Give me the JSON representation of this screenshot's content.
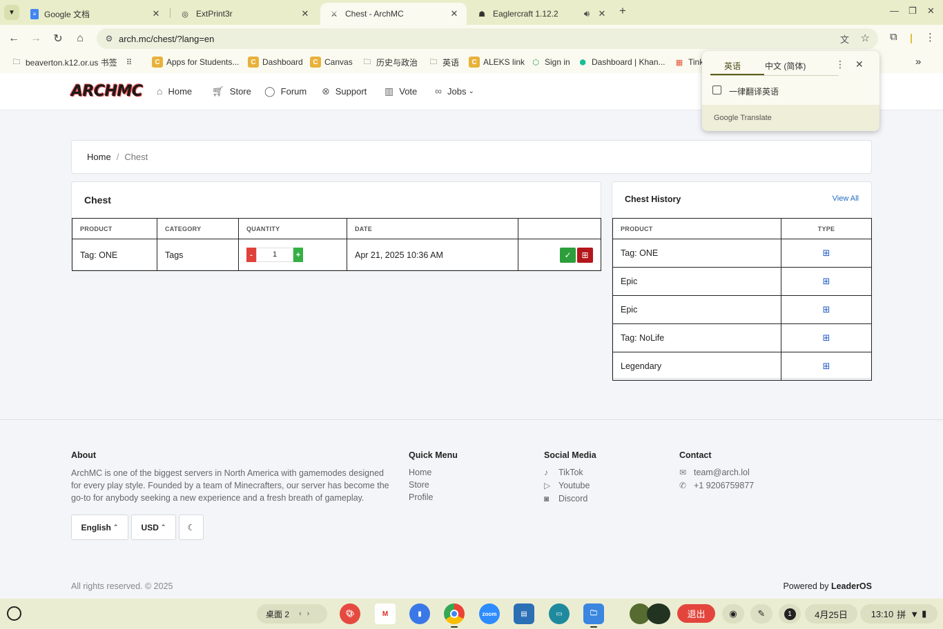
{
  "browser": {
    "tabs": [
      {
        "title": "Google 文档",
        "icon": "google-docs-icon"
      },
      {
        "title": "ExtPrint3r",
        "icon": "globe-icon"
      },
      {
        "title": "Chest - ArchMC",
        "icon": "archmc-icon"
      },
      {
        "title": "Eaglercraft 1.12.2",
        "icon": "eaglercraft-icon"
      }
    ],
    "url": "arch.mc/chest/?lang=en",
    "bookmarks": [
      {
        "label": "beaverton.k12.or.us 书签",
        "icon": "folder-icon"
      },
      {
        "label": "",
        "icon": "apps-grid-icon"
      },
      {
        "label": "Apps for Students...",
        "icon": "c-icon"
      },
      {
        "label": "Dashboard",
        "icon": "c-icon"
      },
      {
        "label": "Canvas",
        "icon": "c-icon"
      },
      {
        "label": "历史与政治",
        "icon": "folder-icon"
      },
      {
        "label": "英语",
        "icon": "folder-icon"
      },
      {
        "label": "ALEKS link",
        "icon": "c-icon"
      },
      {
        "label": "Sign in",
        "icon": "gear-icon"
      },
      {
        "label": "Dashboard | Khan...",
        "icon": "khan-icon"
      },
      {
        "label": "Tink",
        "icon": "tinkercad-icon"
      }
    ]
  },
  "translate_popup": {
    "lang_source": "英语",
    "lang_target": "中文 (简体)",
    "always_translate": "一律翻译英语",
    "brand": "Google Translate"
  },
  "site": {
    "logo": "ARCHMC",
    "nav": [
      {
        "label": "Home",
        "icon": "home-icon"
      },
      {
        "label": "Store",
        "icon": "cart-icon"
      },
      {
        "label": "Forum",
        "icon": "chat-icon"
      },
      {
        "label": "Support",
        "icon": "lifebuoy-icon"
      },
      {
        "label": "Vote",
        "icon": "chart-icon"
      },
      {
        "label": "Jobs",
        "icon": "link-icon"
      }
    ]
  },
  "breadcrumb": {
    "home": "Home",
    "sep": "/",
    "current": "Chest"
  },
  "chest": {
    "title": "Chest",
    "headers": [
      "PRODUCT",
      "CATEGORY",
      "QUANTITY",
      "DATE",
      ""
    ],
    "rows": [
      {
        "product": "Tag: ONE",
        "category": "Tags",
        "quantity": "1",
        "date": "Apr 21, 2025 10:36 AM"
      }
    ],
    "minus_label": "-",
    "plus_label": "+"
  },
  "history": {
    "title": "Chest History",
    "view_all": "View All",
    "headers": [
      "PRODUCT",
      "TYPE"
    ],
    "rows": [
      {
        "product": "Tag: ONE",
        "type_icon": "gift-icon"
      },
      {
        "product": "Epic",
        "type_icon": "gift-icon"
      },
      {
        "product": "Epic",
        "type_icon": "gift-icon"
      },
      {
        "product": "Tag: NoLife",
        "type_icon": "gift-icon"
      },
      {
        "product": "Legendary",
        "type_icon": "gift-icon"
      }
    ]
  },
  "footer": {
    "about_title": "About",
    "about_text": "ArchMC is one of the biggest servers in North America with gamemodes designed for every play style. Founded by a team of Minecrafters, our server has become the go-to for anybody seeking a new experience and a fresh breath of gameplay.",
    "quick_title": "Quick Menu",
    "quick_links": [
      "Home",
      "Store",
      "Profile"
    ],
    "social_title": "Social Media",
    "social_links": [
      "TikTok",
      "Youtube",
      "Discord"
    ],
    "contact_title": "Contact",
    "email": "team@arch.lol",
    "phone": "+1 9206759877",
    "language_btn": "English",
    "currency_btn": "USD",
    "copyright": "All rights reserved. © 2025",
    "powered_prefix": "Powered by ",
    "powered_brand": "LeaderOS"
  },
  "taskbar": {
    "desk": "桌面 2",
    "exit": "退出",
    "notification_count": "1",
    "date": "4月25日",
    "time": "13:10",
    "ime": "拼"
  }
}
